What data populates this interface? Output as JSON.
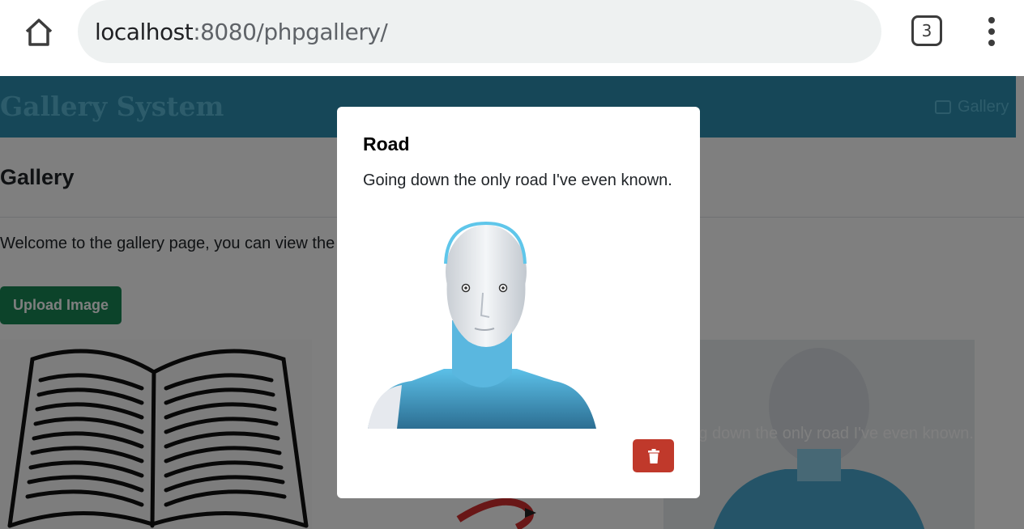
{
  "browser": {
    "url_host": "localhost",
    "url_rest": ":8080/phpgallery/",
    "tab_count": "3",
    "icons": [
      "home-icon",
      "tabs-icon",
      "more-vert-icon"
    ]
  },
  "navbar": {
    "brand": "Gallery System",
    "link_label": "Gallery",
    "link_icon": "image-icon",
    "color": "#2c8fb0"
  },
  "main": {
    "heading": "Gallery",
    "welcome_text": "Welcome to the gallery page, you can view the",
    "upload_button": "Upload Image",
    "upload_color": "#198754"
  },
  "cards": [
    {
      "image": "open-book-drawing"
    },
    {
      "image": "red-logo"
    },
    {
      "image": "robot-head",
      "caption": "Going down the only road I've even known."
    }
  ],
  "modal": {
    "title": "Road",
    "description": "Going down the only road I've even known.",
    "image": "robot-head",
    "delete_icon": "trash-icon",
    "delete_color": "#c0392b"
  }
}
